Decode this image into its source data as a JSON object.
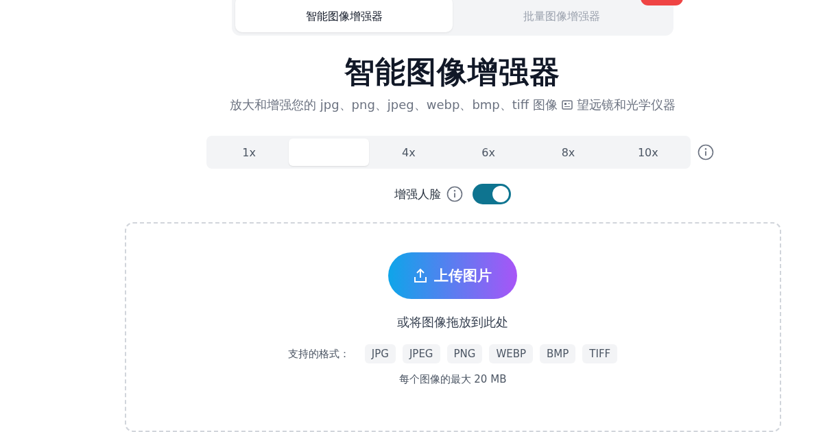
{
  "mode_tabs": [
    {
      "label": "智能图像增强器",
      "selected": true
    },
    {
      "label": "批量图像增强器",
      "selected": false
    }
  ],
  "title": "智能图像增强器",
  "subtitle": {
    "text": "放大和增强您的 jpg、png、jpeg、webp、bmp、tiff 图像",
    "link": "望远镜和光学仪器"
  },
  "scales": [
    {
      "label": "1x",
      "selected": false
    },
    {
      "selected": true
    },
    {
      "label": "4x",
      "selected": false
    },
    {
      "label": "6x",
      "selected": false
    },
    {
      "label": "8x",
      "selected": false
    },
    {
      "label": "10x",
      "selected": false
    }
  ],
  "face_enhance": {
    "label": "增强人脸",
    "on": true
  },
  "upload": {
    "button": "上传图片",
    "hint": "或将图像拖放到此处",
    "formats_label": "支持的格式：",
    "formats": [
      "JPG",
      "JPEG",
      "PNG",
      "WEBP",
      "BMP",
      "TIFF"
    ],
    "limit": "每个图像的最大 20 MB"
  }
}
